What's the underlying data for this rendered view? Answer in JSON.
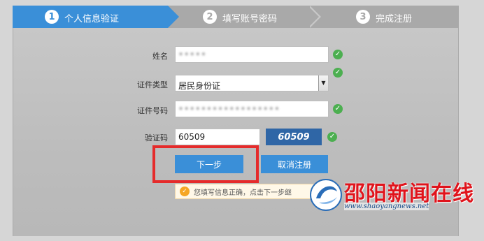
{
  "steps": [
    {
      "number": "1",
      "label": "个人信息验证",
      "active": true
    },
    {
      "number": "2",
      "label": "填写账号密码",
      "active": false
    },
    {
      "number": "3",
      "label": "完成注册",
      "active": false
    }
  ],
  "form": {
    "name": {
      "label": "姓名",
      "value": "•••••"
    },
    "id_type": {
      "label": "证件类型",
      "value": "居民身份证"
    },
    "id_number": {
      "label": "证件号码",
      "value": "••••••••••••••••••"
    },
    "captcha": {
      "label": "验证码",
      "value": "60509",
      "image_text": "60509"
    }
  },
  "buttons": {
    "next": "下一步",
    "cancel": "取消注册"
  },
  "tip": "您填写信息正确，点击下一步继",
  "watermark": {
    "name": "邵阳新闻在线",
    "url": "www.shaoyangnews.net"
  },
  "colors": {
    "accent": "#3a8fd8",
    "check": "#4caf50",
    "highlight": "#e52b2b",
    "captcha_bg": "#2f66a6"
  }
}
